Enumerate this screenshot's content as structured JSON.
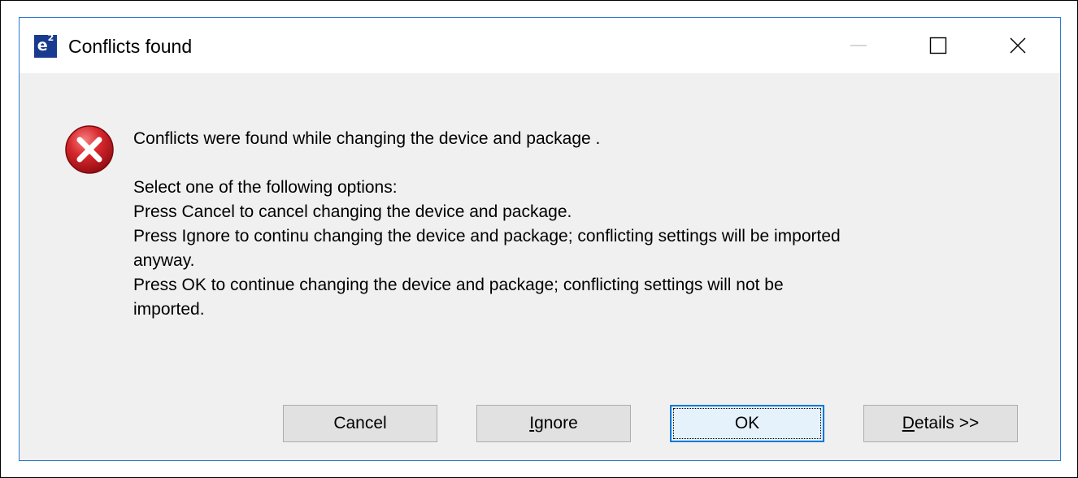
{
  "dialog": {
    "app_logo": "e²",
    "title": "Conflicts found",
    "error_icon": "error-x-icon",
    "headline": "Conflicts were found while changing the device and package .",
    "lines": [
      "Select one of the following options:",
      "Press Cancel to cancel changing the device and package.",
      "Press Ignore to continu changing the device and package; conflicting settings will be imported",
      "anyway.",
      "Press OK to continue changing the device and package; conflicting settings will not be",
      "imported."
    ],
    "buttons": {
      "cancel": "Cancel",
      "ignore_mnemonic": "I",
      "ignore_rest": "gnore",
      "ok": "OK",
      "details_mnemonic": "D",
      "details_rest": "etails >>"
    }
  },
  "colors": {
    "window_border": "#2b79d0",
    "dialog_bg": "#f0f0f0",
    "button_bg": "#e1e1e1",
    "default_button_border": "#0078d7",
    "error_red": "#c8161d",
    "logo_blue": "#1a3a8f"
  }
}
